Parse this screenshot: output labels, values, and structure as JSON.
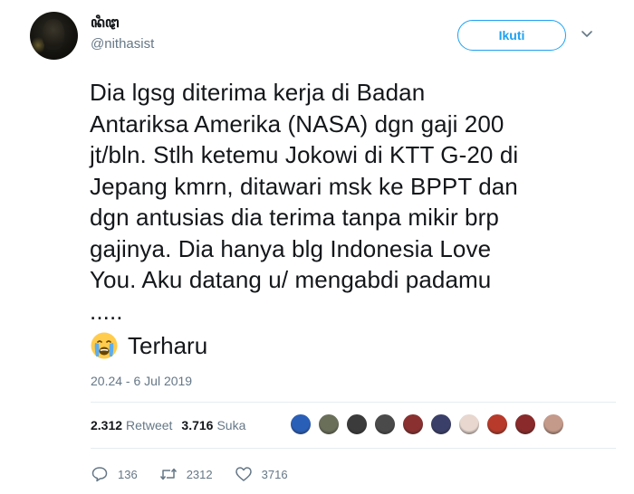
{
  "user": {
    "display_name": "ꦤꦶꦛ",
    "handle": "@nithasist"
  },
  "follow_button": {
    "label": "Ikuti"
  },
  "tweet": {
    "text": "Dia lgsg diterima kerja di Badan\nAntariksa Amerika (NASA) dgn gaji 200\njt/bln. Stlh ketemu Jokowi di KTT G-20 di\nJepang kmrn, ditawari msk ke BPPT dan\ndgn antusias dia terima tanpa mikir brp\ngajinya. Dia hanya blg Indonesia Love\nYou. Aku datang u/ mengabdi padamu\n.....",
    "emoji_icon": "crying-face-emoji",
    "emoji_text": "Terharu",
    "timestamp": "20.24 - 6 Jul 2019"
  },
  "stats": {
    "retweets": "2.312",
    "retweet_label": "Retweet",
    "likes": "3.716",
    "likes_label": "Suka"
  },
  "liker_avatar_colors": [
    "#2a5fb8",
    "#6a6f5a",
    "#3b3b3b",
    "#4a4a4a",
    "#8a3030",
    "#3a3f6a",
    "#e7d7cf",
    "#b83a2a",
    "#8a2a2a",
    "#c49a8a"
  ],
  "actions": {
    "reply_count": "136",
    "retweet_count": "2312",
    "like_count": "3716"
  },
  "colors": {
    "accent": "#1da1f2",
    "text": "#14171a",
    "secondary": "#657786"
  }
}
